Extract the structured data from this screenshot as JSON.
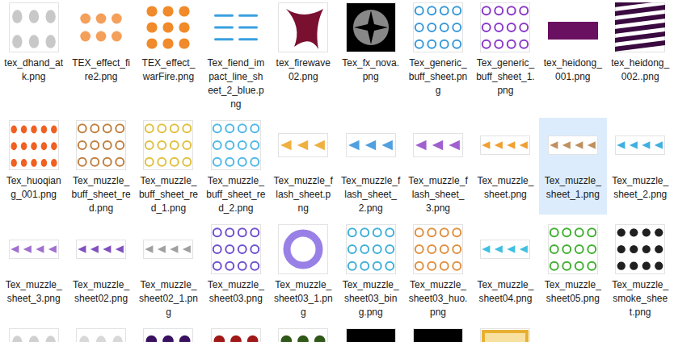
{
  "files": [
    {
      "label": "tex_dhand_atk.png",
      "selected": false
    },
    {
      "label": "TEX_effect_fire2.png",
      "selected": false
    },
    {
      "label": "TEX_effect_warFire.png",
      "selected": false
    },
    {
      "label": "Tex_fiend_impact_line_sheet_2_blue.png",
      "selected": false
    },
    {
      "label": "tex_firewave02.png",
      "selected": false
    },
    {
      "label": "Tex_fx_nova.png",
      "selected": false
    },
    {
      "label": "Tex_generic_buff_sheet.png",
      "selected": false
    },
    {
      "label": "Tex_generic_buff_sheet_1.png",
      "selected": false
    },
    {
      "label": "tex_heidong_001.png",
      "selected": false
    },
    {
      "label": "tex_heidong_002..png",
      "selected": false
    },
    {
      "label": "Tex_huoqiang_001.png",
      "selected": false
    },
    {
      "label": "Tex_muzzle_buff_sheet_red.png",
      "selected": false
    },
    {
      "label": "Tex_muzzle_buff_sheet_red_1.png",
      "selected": false
    },
    {
      "label": "Tex_muzzle_buff_sheet_red_2.png",
      "selected": false
    },
    {
      "label": "Tex_muzzle_flash_sheet.png",
      "selected": false
    },
    {
      "label": "Tex_muzzle_flash_sheet_2.png",
      "selected": false
    },
    {
      "label": "Tex_muzzle_flash_sheet_3.png",
      "selected": false
    },
    {
      "label": "Tex_muzzle_sheet.png",
      "selected": false
    },
    {
      "label": "Tex_muzzle_sheet_1.png",
      "selected": true
    },
    {
      "label": "Tex_muzzle_sheet_2.png",
      "selected": false
    },
    {
      "label": "Tex_muzzle_sheet_3.png",
      "selected": false
    },
    {
      "label": "Tex_muzzle_sheet02.png",
      "selected": false
    },
    {
      "label": "Tex_muzzle_sheet02_1.png",
      "selected": false
    },
    {
      "label": "Tex_muzzle_sheet03.png",
      "selected": false
    },
    {
      "label": "Tex_muzzle_sheet03_1.png",
      "selected": false
    },
    {
      "label": "Tex_muzzle_sheet03_bing.png",
      "selected": false
    },
    {
      "label": "Tex_muzzle_sheet03_huo.png",
      "selected": false
    },
    {
      "label": "Tex_muzzle_sheet04.png",
      "selected": false
    },
    {
      "label": "Tex_muzzle_sheet05.png",
      "selected": false
    },
    {
      "label": "Tex_muzzle_smoke_sheet.png",
      "selected": false
    },
    {
      "selected": false
    },
    {
      "selected": false
    },
    {
      "selected": false
    },
    {
      "selected": false
    },
    {
      "selected": false
    },
    {
      "selected": false
    },
    {
      "selected": false
    },
    {
      "selected": false
    }
  ]
}
